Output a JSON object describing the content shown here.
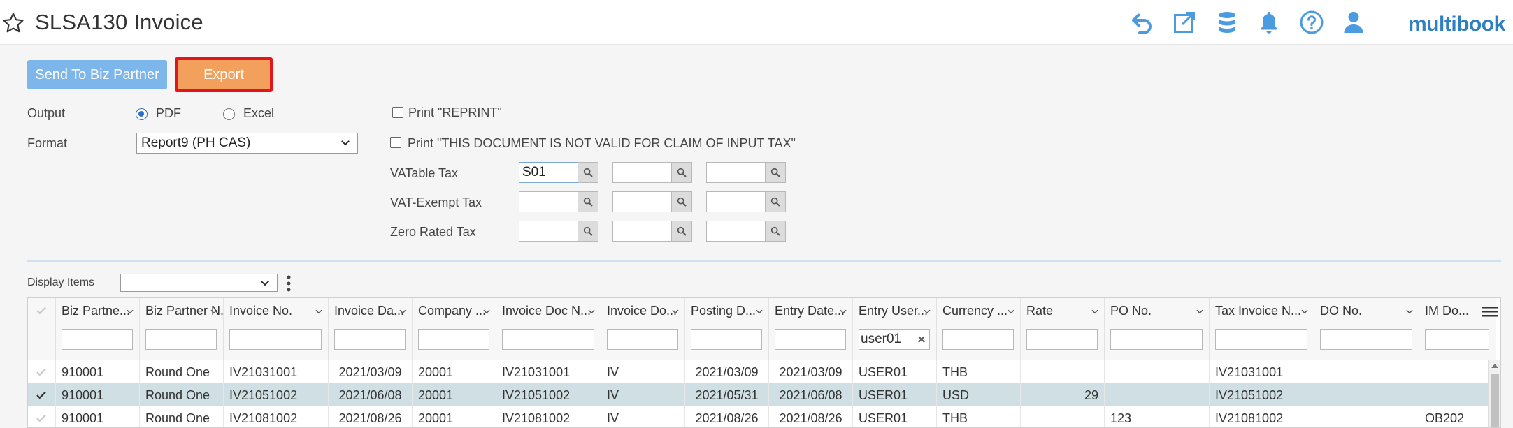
{
  "header": {
    "title": "SLSA130 Invoice",
    "brand": "multibook",
    "icons": [
      "undo-icon",
      "popout-icon",
      "database-icon",
      "bell-icon",
      "help-icon",
      "user-icon"
    ],
    "accent": "#4a9be0"
  },
  "toolbar": {
    "send_label": "Send To Biz Partner",
    "export_label": "Export"
  },
  "form": {
    "output_label": "Output",
    "output_options": [
      "PDF",
      "Excel"
    ],
    "output_selected": "PDF",
    "format_label": "Format",
    "format_value": "Report9 (PH CAS)",
    "print_reprint_label": "Print \"REPRINT\"",
    "print_invalid_label": "Print \"THIS DOCUMENT IS NOT VALID FOR CLAIM OF INPUT TAX\"",
    "vatable_label": "VATable Tax",
    "vatable_value": "S01",
    "vatexempt_label": "VAT-Exempt Tax",
    "zerorated_label": "Zero Rated Tax"
  },
  "display": {
    "label": "Display Items",
    "value": ""
  },
  "grid": {
    "columns": [
      "Biz Partne...",
      "Biz Partner N...",
      "Invoice No.",
      "Invoice Da...",
      "Company ...",
      "Invoice Doc N...",
      "Invoice Do...",
      "Posting D...",
      "Entry Date...",
      "Entry User...",
      "Currency ...",
      "Rate",
      "PO No.",
      "Tax Invoice N...",
      "DO No.",
      "IM Do..."
    ],
    "entry_user_filter": "user01",
    "rows": [
      {
        "bp": "910001",
        "bpname": "Round One",
        "inv": "IV21031001",
        "invdate": "2021/03/09",
        "company": "20001",
        "invdoc": "IV21031001",
        "invdoctype": "IV",
        "posting": "2021/03/09",
        "entry": "2021/03/09",
        "user": "USER01",
        "currency": "THB",
        "rate": "",
        "po": "",
        "taxinv": "IV21031001",
        "do": "",
        "imdoc": ""
      },
      {
        "bp": "910001",
        "bpname": "Round One",
        "inv": "IV21051002",
        "invdate": "2021/06/08",
        "company": "20001",
        "invdoc": "IV21051002",
        "invdoctype": "IV",
        "posting": "2021/05/31",
        "entry": "2021/06/08",
        "user": "USER01",
        "currency": "USD",
        "rate": "29",
        "po": "",
        "taxinv": "IV21051002",
        "do": "",
        "imdoc": ""
      },
      {
        "bp": "910001",
        "bpname": "Round One",
        "inv": "IV21081002",
        "invdate": "2021/08/26",
        "company": "20001",
        "invdoc": "IV21081002",
        "invdoctype": "IV",
        "posting": "2021/08/26",
        "entry": "2021/08/26",
        "user": "USER01",
        "currency": "THB",
        "rate": "",
        "po": "123",
        "taxinv": "IV21081002",
        "do": "",
        "imdoc": "OB202"
      }
    ]
  }
}
